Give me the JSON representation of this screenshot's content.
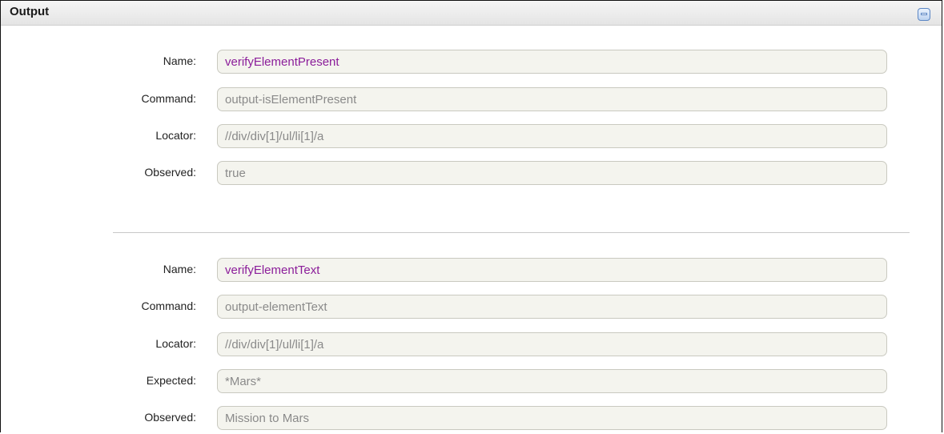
{
  "panel": {
    "title": "Output",
    "collapse_icon": "minus-icon"
  },
  "groups": [
    {
      "name_label": "Name:",
      "name_value": "verifyElementPresent",
      "command_label": "Command:",
      "command_value": "output-isElementPresent",
      "locator_label": "Locator:",
      "locator_value": "//div/div[1]/ul/li[1]/a",
      "observed_label": "Observed:",
      "observed_value": "true"
    },
    {
      "name_label": "Name:",
      "name_value": "verifyElementText",
      "command_label": "Command:",
      "command_value": "output-elementText",
      "locator_label": "Locator:",
      "locator_value": "//div/div[1]/ul/li[1]/a",
      "expected_label": "Expected:",
      "expected_value": "*Mars*",
      "observed_label": "Observed:",
      "observed_value": "Mission to Mars"
    }
  ],
  "colors": {
    "name_value": "#8b1d9a",
    "field_text": "#8a8a8a",
    "field_background": "#f4f4ee"
  }
}
